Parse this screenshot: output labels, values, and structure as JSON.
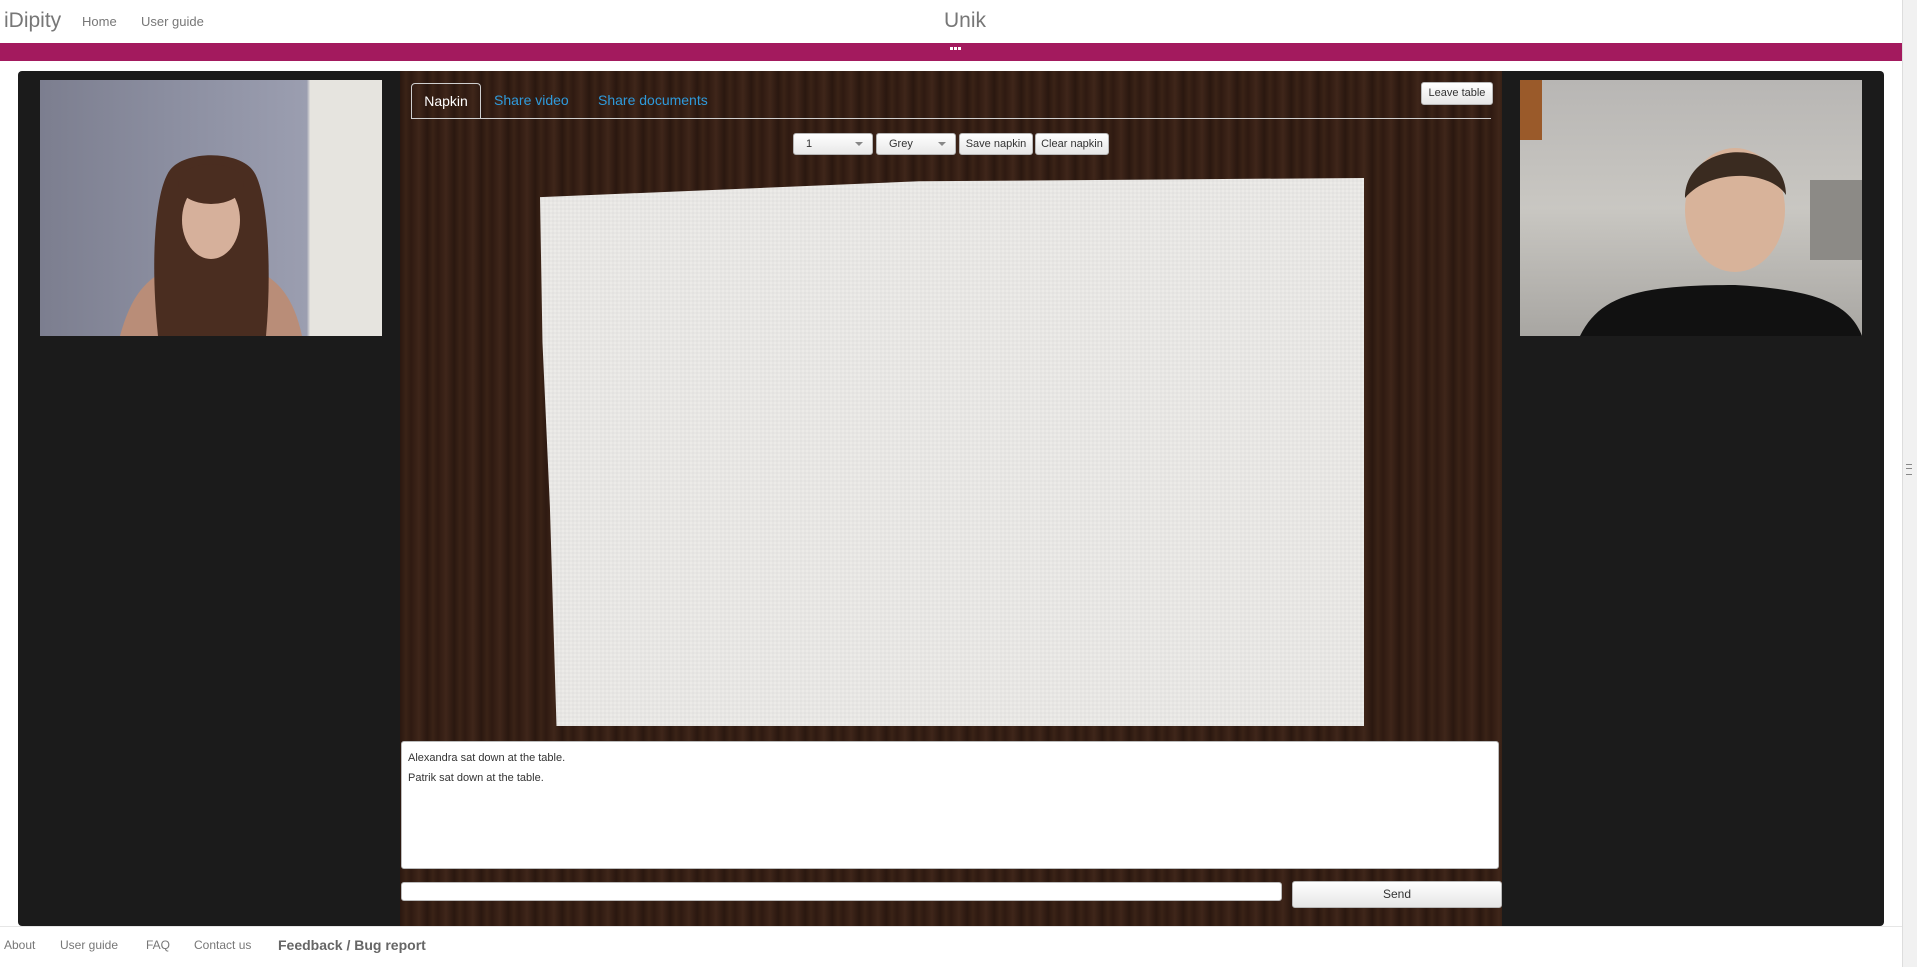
{
  "header": {
    "brand": "iDipity",
    "nav": [
      "Home",
      "User guide"
    ],
    "title": "Unik",
    "accent_color": "#a31a5e"
  },
  "tabs": {
    "items": [
      "Napkin",
      "Share video",
      "Share documents"
    ],
    "active": "Napkin"
  },
  "actions": {
    "leave_label": "Leave table"
  },
  "toolbar": {
    "size_value": "1",
    "color_value": "Grey",
    "save_label": "Save napkin",
    "clear_label": "Clear napkin"
  },
  "video": {
    "left_icon": "webcam-participant-1",
    "right_icon": "webcam-participant-2"
  },
  "chat": {
    "messages": [
      "Alexandra sat down at the table.",
      "Patrik sat down at the table."
    ],
    "input_value": "",
    "send_label": "Send"
  },
  "footer": {
    "links": [
      "About",
      "User guide",
      "FAQ",
      "Contact us"
    ],
    "feedback": "Feedback / Bug report"
  },
  "colors": {
    "link_blue": "#2f9adb",
    "panel_dark": "#1b1b1b",
    "wood": "#3a2317"
  }
}
